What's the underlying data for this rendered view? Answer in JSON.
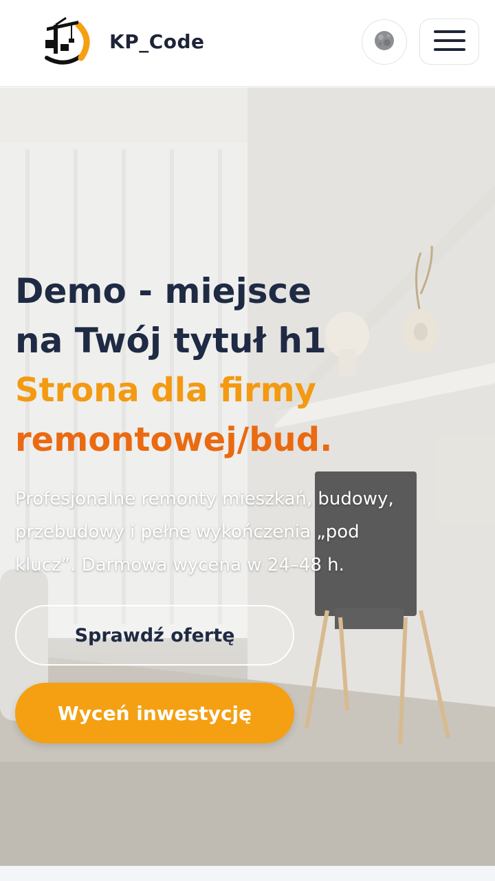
{
  "header": {
    "brand": "KP_Code",
    "logo_icon": "crane-logo-icon",
    "theme_toggle_icon": "moon-icon",
    "menu_icon": "hamburger-menu-icon"
  },
  "hero": {
    "title_lines": [
      "Demo - miejsce",
      "na Twój tytuł h1"
    ],
    "subtitle_lines": [
      "Strona dla firmy",
      "remontowej/bud."
    ],
    "description_lines": [
      "Profesjonalne remonty mieszkań, budowy,",
      "przebudowy i pełne wykończenia „pod",
      "klucz”. Darmowa wycena w 24–48 h."
    ],
    "secondary_button": "Sprawdź ofertę",
    "primary_button": "Wyceń inwestycję"
  },
  "colors": {
    "accent_orange": "#f4a012",
    "subtitle_orange_dark": "#ea6a12",
    "title_navy": "#1f2a44"
  }
}
